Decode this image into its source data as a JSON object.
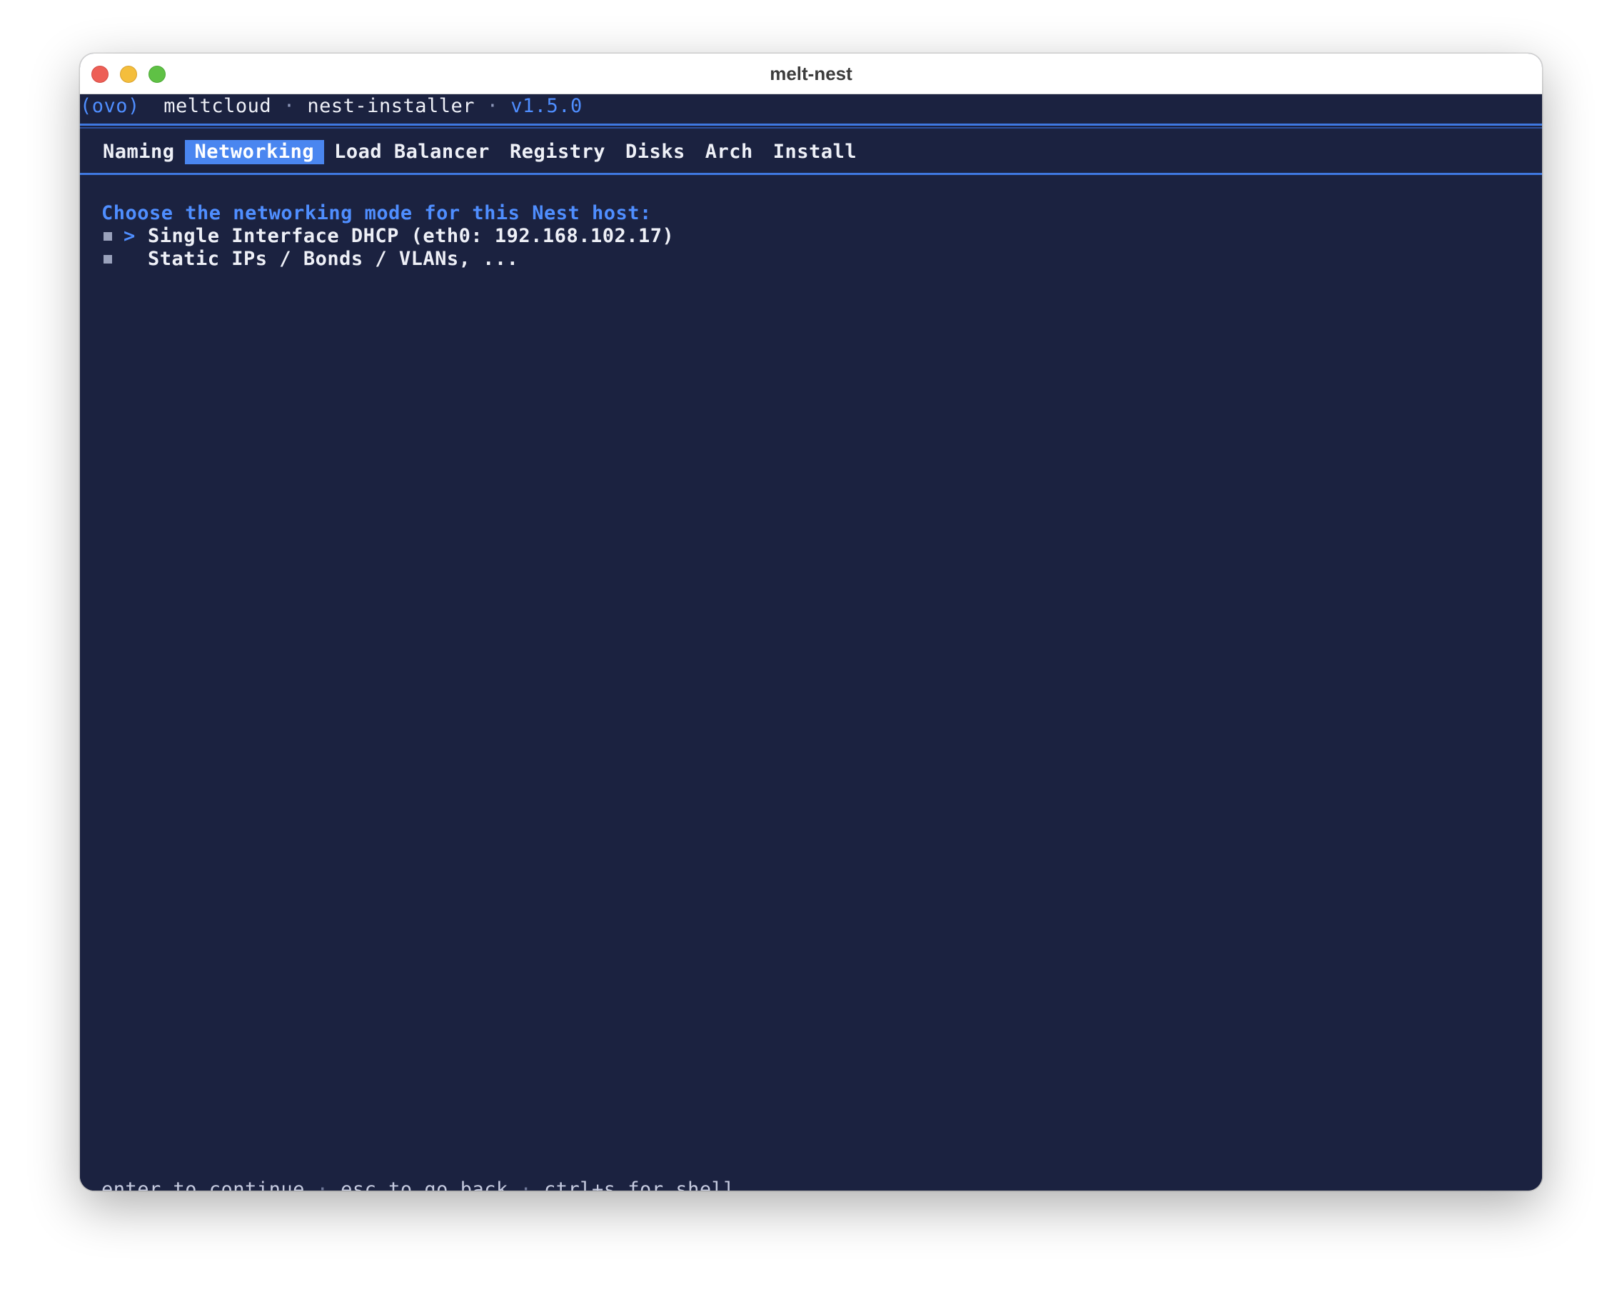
{
  "window": {
    "title": "melt-nest"
  },
  "header": {
    "logo": "(ovo)",
    "brand": "meltcloud",
    "separator1": "·",
    "app": "nest-installer",
    "separator2": "·",
    "version": "v1.5.0"
  },
  "tabs": [
    {
      "label": "Naming",
      "active": false
    },
    {
      "label": "Networking",
      "active": true
    },
    {
      "label": "Load Balancer",
      "active": false
    },
    {
      "label": "Registry",
      "active": false
    },
    {
      "label": "Disks",
      "active": false
    },
    {
      "label": "Arch",
      "active": false
    },
    {
      "label": "Install",
      "active": false
    }
  ],
  "main": {
    "prompt": "Choose the networking mode for this Nest host:",
    "options": [
      {
        "label": "Single Interface DHCP (eth0: 192.168.102.17)",
        "selected": true,
        "caret": ">"
      },
      {
        "label": "Static IPs / Bonds / VLANs, ...",
        "selected": false,
        "caret": ">"
      }
    ]
  },
  "footer": {
    "hint1": "enter to continue",
    "sep1": "·",
    "hint2": "esc to go back",
    "sep2": "·",
    "hint3": "ctrl+s for shell"
  },
  "colors": {
    "background": "#1b2240",
    "accent": "#4a86f0",
    "text": "#eef0f7"
  }
}
